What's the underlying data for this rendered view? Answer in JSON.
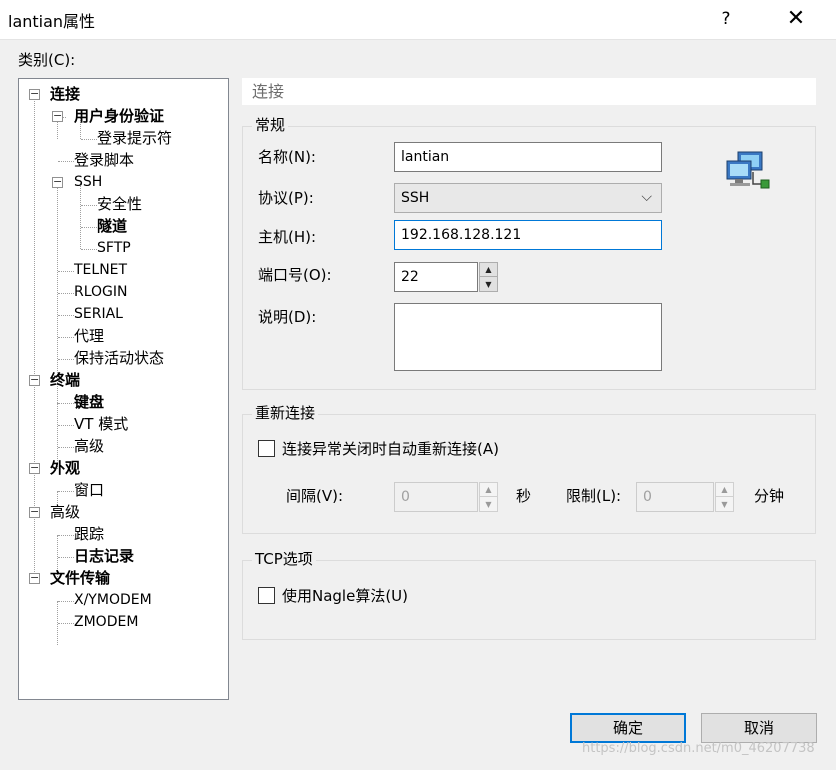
{
  "window": {
    "title": "lantian属性",
    "help_icon": "?",
    "close_icon": "✕"
  },
  "category": {
    "label": "类别(C):",
    "tree": [
      {
        "label": "连接",
        "bold": true,
        "expander": "−"
      },
      {
        "label": "用户身份验证",
        "bold": true,
        "expander": "−"
      },
      {
        "label": "登录提示符",
        "bold": false
      },
      {
        "label": "登录脚本",
        "bold": false
      },
      {
        "label": "SSH",
        "bold": false,
        "expander": "−"
      },
      {
        "label": "安全性",
        "bold": false
      },
      {
        "label": "隧道",
        "bold": true
      },
      {
        "label": "SFTP",
        "bold": false
      },
      {
        "label": "TELNET",
        "bold": false
      },
      {
        "label": "RLOGIN",
        "bold": false
      },
      {
        "label": "SERIAL",
        "bold": false
      },
      {
        "label": "代理",
        "bold": false
      },
      {
        "label": "保持活动状态",
        "bold": false
      },
      {
        "label": "终端",
        "bold": true,
        "expander": "−"
      },
      {
        "label": "键盘",
        "bold": true
      },
      {
        "label": "VT 模式",
        "bold": false
      },
      {
        "label": "高级",
        "bold": false
      },
      {
        "label": "外观",
        "bold": true,
        "expander": "−"
      },
      {
        "label": "窗口",
        "bold": false
      },
      {
        "label": "高级",
        "bold": false,
        "expander": "−"
      },
      {
        "label": "跟踪",
        "bold": false
      },
      {
        "label": "日志记录",
        "bold": true
      },
      {
        "label": "文件传输",
        "bold": true,
        "expander": "−"
      },
      {
        "label": "X/YMODEM",
        "bold": false
      },
      {
        "label": "ZMODEM",
        "bold": false
      }
    ]
  },
  "panel": {
    "header": "连接",
    "general": {
      "group_label": "常规",
      "name_label": "名称(N):",
      "name_value": "lantian",
      "protocol_label": "协议(P):",
      "protocol_value": "SSH",
      "protocol_arrow": "⌵",
      "host_label": "主机(H):",
      "host_value": "192.168.128.121",
      "port_label": "端口号(O):",
      "port_value": "22",
      "desc_label": "说明(D):",
      "desc_value": "",
      "icon": "network-computers-icon"
    },
    "reconnect": {
      "group_label": "重新连接",
      "checkbox_label": "连接异常关闭时自动重新连接(A)",
      "checked": false,
      "interval_label": "间隔(V):",
      "interval_value": "0",
      "interval_unit": "秒",
      "limit_label": "限制(L):",
      "limit_value": "0",
      "limit_unit": "分钟"
    },
    "tcp": {
      "group_label": "TCP选项",
      "nagle_label": "使用Nagle算法(U)",
      "checked": false
    }
  },
  "buttons": {
    "ok": "确定",
    "cancel": "取消"
  },
  "watermark": "https://blog.csdn.net/m0_46207738",
  "colors": {
    "focus_border": "#0078d7",
    "panel_header_text": "#6d6d6d"
  }
}
